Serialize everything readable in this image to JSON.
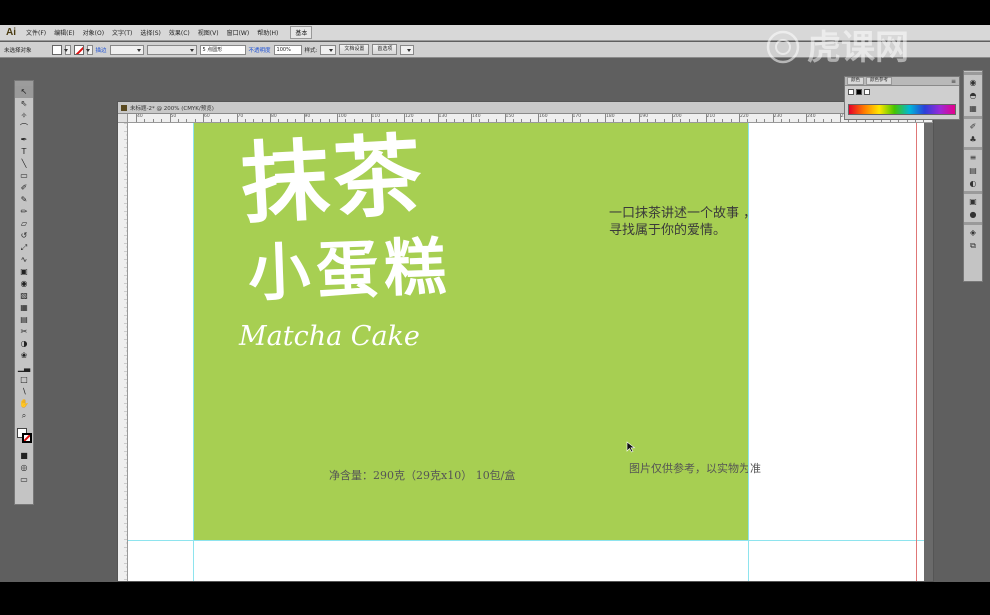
{
  "app": {
    "logo": "Ai",
    "menu": [
      "文件(F)",
      "编辑(E)",
      "对象(O)",
      "文字(T)",
      "选择(S)",
      "效果(C)",
      "视图(V)",
      "窗口(W)",
      "帮助(H)"
    ],
    "menu_extra": "基本"
  },
  "controlbar": {
    "selection_status": "未选择对象",
    "stroke_link": "描边",
    "stroke_style": "5 点圆形",
    "opacity_link": "不透明度",
    "opacity_value": "100%",
    "style_label": "样式:",
    "doc_setup_button": "文档设置",
    "preferences_button": "首选项"
  },
  "watermark": {
    "text": "虎课网"
  },
  "document": {
    "tab_title": "未标题-2* @ 200% (CMYK/预览)",
    "ruler_labels": [
      "40",
      "50",
      "60",
      "70",
      "80",
      "90",
      "100",
      "110",
      "120",
      "130",
      "140",
      "150",
      "160",
      "170",
      "180",
      "190",
      "200",
      "210",
      "220",
      "230",
      "240",
      "250",
      "260",
      "270"
    ],
    "artboard_color": "#a7cf52"
  },
  "artwork": {
    "title_line1": "抹茶",
    "title_line2": "小蛋糕",
    "title_en": "Matcha Cake",
    "slogan_line1": "一口抹茶讲述一个故事 ，",
    "slogan_line2": "寻找属于你的爱情。",
    "net_weight": "净含量：290克（29克x10） 10包/盒",
    "disclaimer": "图片仅供参考，以实物为准"
  },
  "color_panel": {
    "tabs": [
      "颜色",
      "颜色参考"
    ],
    "spectrum": "color-spectrum"
  },
  "icons": {
    "tools": [
      "selection-icon",
      "direct-selection-icon",
      "magic-wand-icon",
      "lasso-icon",
      "pen-icon",
      "type-icon",
      "line-icon",
      "rectangle-icon",
      "paintbrush-icon",
      "pencil-icon",
      "blob-brush-icon",
      "eraser-icon",
      "rotate-icon",
      "scale-icon",
      "warp-icon",
      "free-transform-icon",
      "shape-builder-icon",
      "perspective-icon",
      "mesh-icon",
      "gradient-icon",
      "eyedropper-icon",
      "blend-icon",
      "symbol-sprayer-icon",
      "graph-icon",
      "artboard-icon",
      "slice-icon",
      "hand-icon",
      "zoom-icon"
    ]
  }
}
